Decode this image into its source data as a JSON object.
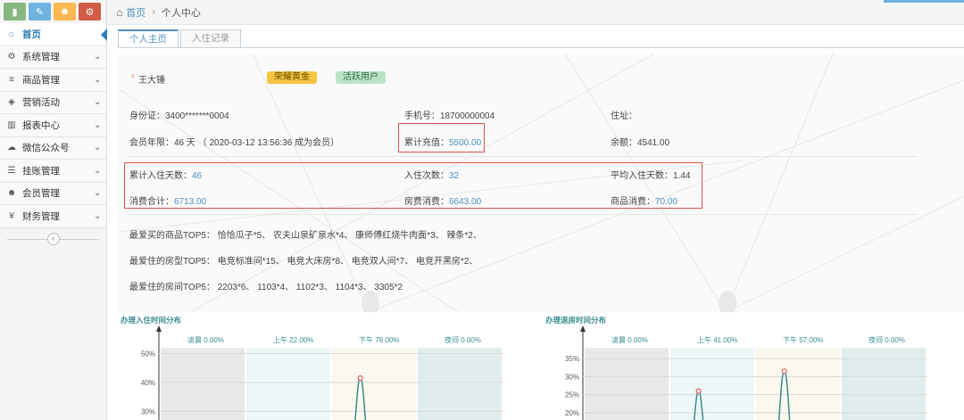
{
  "sidebar": {
    "items": [
      {
        "label": "首页",
        "icon": "home-icon",
        "glyph": "⌂"
      },
      {
        "label": "系统管理",
        "icon": "gear-icon",
        "glyph": "⚙"
      },
      {
        "label": "商品管理",
        "icon": "database-icon",
        "glyph": "≡"
      },
      {
        "label": "营销活动",
        "icon": "gift-icon",
        "glyph": "◈"
      },
      {
        "label": "报表中心",
        "icon": "bar-chart-icon",
        "glyph": "▥"
      },
      {
        "label": "微信公众号",
        "icon": "cloud-icon",
        "glyph": "☁"
      },
      {
        "label": "挂账管理",
        "icon": "list-icon",
        "glyph": "☰"
      },
      {
        "label": "会员管理",
        "icon": "users-icon",
        "glyph": "☻"
      },
      {
        "label": "财务管理",
        "icon": "cutlery-icon",
        "glyph": "¥"
      }
    ],
    "collapse_glyph": "«"
  },
  "breadcrumb": {
    "home": "首页",
    "separator": "›",
    "current": "个人中心"
  },
  "tabs": [
    {
      "label": "个人主页",
      "active": true
    },
    {
      "label": "入住记录",
      "active": false
    }
  ],
  "profile": {
    "name_glyph": "♁",
    "name": "王大锤",
    "badges": [
      "荣耀黄金",
      "活跃用户"
    ],
    "id_label": "身份证：",
    "id_value": "3400*******0004",
    "phone_label": "手机号：",
    "phone_value": "18700000004",
    "address_label": "住址：",
    "member_label": "会员年限：",
    "member_value": "46 天 （ 2020-03-12 13:56:36 成为会员）",
    "recharge_label": "累计充值：",
    "recharge_value": "5500.00",
    "balance_label": "余额：",
    "balance_value": "4541.00",
    "stay_days_label": "累计入住天数：",
    "stay_days_value": "46",
    "stay_count_label": "入住次数：",
    "stay_count_value": "32",
    "avg_days_label": "平均入住天数：",
    "avg_days_value": "1.44",
    "total_spend_label": "消费合计：",
    "total_spend_value": "6713.00",
    "room_spend_label": "房费消费：",
    "room_spend_value": "6643.00",
    "goods_spend_label": "商品消费：",
    "goods_spend_value": "70.00",
    "top_goods": "最爱买的商品TOP5： 恰恰瓜子*5、 农夫山泉矿泉水*4、 康师傅红烧牛肉面*3、 辣条*2、",
    "top_room_types": "最爱住的房型TOP5： 电竞标准间*15、 电竞大床房*8、 电竞双人间*7、 电竞开黑房*2、",
    "top_rooms": "最爱住的房间TOP5： 2203*6、 1103*4、 1102*3、 1104*3、 3305*2"
  },
  "colors": {
    "accent": "#4c8fbd",
    "red_box": "#d9534f",
    "chart_line": "#3a8b8e",
    "peak_marker": "#e05555"
  },
  "chart_data": [
    {
      "type": "line",
      "title": "办理入住时间分布",
      "y_ticks": [
        "50%",
        "40%",
        "30%"
      ],
      "ylim_visible": [
        27,
        52
      ],
      "bands": [
        {
          "label": "凌晨",
          "value": "0.00%"
        },
        {
          "label": "上午",
          "value": "22.00%"
        },
        {
          "label": "下午",
          "value": "79.00%"
        },
        {
          "label": "夜间",
          "value": "0.00%"
        }
      ],
      "peaks": [
        {
          "band": 2,
          "value": 41.5
        }
      ]
    },
    {
      "type": "line",
      "title": "办理退房时间分布",
      "y_ticks": [
        "35%",
        "30%",
        "25%",
        "20%"
      ],
      "ylim_visible": [
        18,
        38
      ],
      "bands": [
        {
          "label": "凌晨",
          "value": "0.00%"
        },
        {
          "label": "上午",
          "value": "41.00%"
        },
        {
          "label": "下午",
          "value": "57.00%"
        },
        {
          "label": "夜间",
          "value": "0.00%"
        }
      ],
      "peaks": [
        {
          "band": 1,
          "value": 26
        },
        {
          "band": 2,
          "value": 31.5
        }
      ]
    }
  ]
}
